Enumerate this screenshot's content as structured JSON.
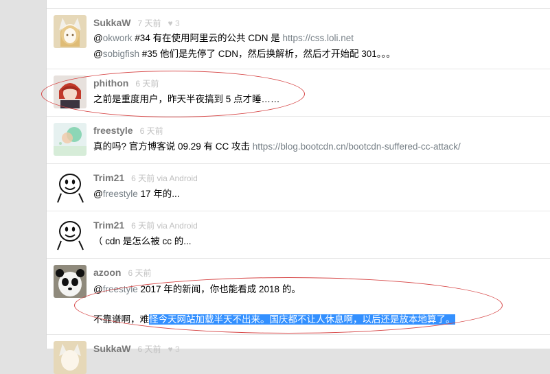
{
  "replies": [
    {
      "user": "SukkaW",
      "ago": "7 天前",
      "likes": "♥ 3",
      "lines": [
        {
          "parts": [
            {
              "t": "@",
              "k": "text"
            },
            {
              "t": "okwork",
              "k": "link"
            },
            {
              "t": " #34 有在使用阿里云的公共 CDN 是 ",
              "k": "text"
            },
            {
              "t": "https://css.loli.net",
              "k": "link"
            }
          ]
        },
        {
          "parts": [
            {
              "t": "@",
              "k": "text"
            },
            {
              "t": "sobigfish",
              "k": "link"
            },
            {
              "t": " #35 他们是先停了 CDN，然后换解析，然后才开始配 301。。。",
              "k": "text"
            }
          ]
        }
      ]
    },
    {
      "user": "phithon",
      "ago": "6 天前",
      "lines": [
        {
          "parts": [
            {
              "t": "之前是重度用户，昨天半夜搞到 5 点才睡……",
              "k": "text"
            }
          ]
        }
      ]
    },
    {
      "user": "freestyle",
      "ago": "6 天前",
      "lines": [
        {
          "parts": [
            {
              "t": "真的吗? 官方博客说 09.29 有 CC 攻击 ",
              "k": "text"
            },
            {
              "t": "https://blog.bootcdn.cn/bootcdn-suffered-cc-attack/",
              "k": "link"
            }
          ]
        }
      ]
    },
    {
      "user": "Trim21",
      "ago": "6 天前 via Android",
      "lines": [
        {
          "parts": [
            {
              "t": "@",
              "k": "text"
            },
            {
              "t": "freestyle",
              "k": "link"
            },
            {
              "t": " 17 年的...",
              "k": "text"
            }
          ]
        }
      ]
    },
    {
      "user": "Trim21",
      "ago": "6 天前 via Android",
      "lines": [
        {
          "parts": [
            {
              "t": "（ cdn 是怎么被 cc 的...",
              "k": "text"
            }
          ]
        }
      ]
    },
    {
      "user": "azoon",
      "ago": "6 天前",
      "lines": [
        {
          "parts": [
            {
              "t": "@",
              "k": "text"
            },
            {
              "t": "freestyle",
              "k": "link"
            },
            {
              "t": " 2017 年的新闻，你也能看成 2018 的。",
              "k": "text"
            }
          ]
        },
        {
          "parts": [
            {
              "t": "不靠谱啊，难",
              "k": "text"
            },
            {
              "t": "怪今天网站加载半天不出来。国庆都不让人休息啊，以后还是放本地算了。",
              "k": "hl"
            }
          ]
        }
      ]
    },
    {
      "user": "SukkaW",
      "ago": "6 天前",
      "likes": "♥ 3",
      "lines": []
    }
  ]
}
